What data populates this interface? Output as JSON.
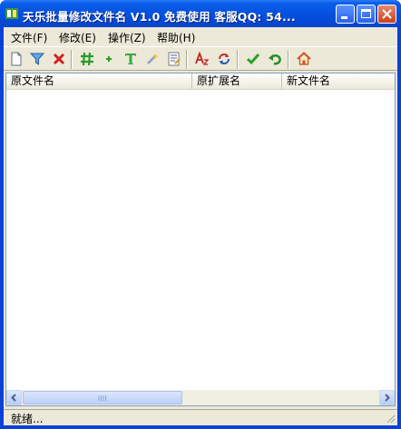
{
  "window": {
    "title": "天乐批量修改文件名 V1.0 免费使用 客服QQ: 54...",
    "accent": "#0553e0"
  },
  "menu": [
    {
      "label": "文件(F)"
    },
    {
      "label": "修改(E)"
    },
    {
      "label": "操作(Z)"
    },
    {
      "label": "帮助(H)"
    }
  ],
  "toolbar": {
    "tools": [
      {
        "icon": "new-document-icon"
      },
      {
        "icon": "filter-icon"
      },
      {
        "icon": "delete-icon"
      },
      {
        "icon": "hash-number-icon"
      },
      {
        "icon": "plus-icon"
      },
      {
        "icon": "text-icon"
      },
      {
        "icon": "wand-icon"
      },
      {
        "icon": "edit-list-icon"
      },
      {
        "icon": "font-case-icon"
      },
      {
        "icon": "swap-icon"
      },
      {
        "icon": "checkmark-icon"
      },
      {
        "icon": "undo-icon"
      },
      {
        "icon": "home-icon"
      }
    ]
  },
  "list": {
    "columns": [
      "原文件名",
      "原扩展名",
      "新文件名"
    ]
  },
  "status": {
    "text": "就绪..."
  }
}
